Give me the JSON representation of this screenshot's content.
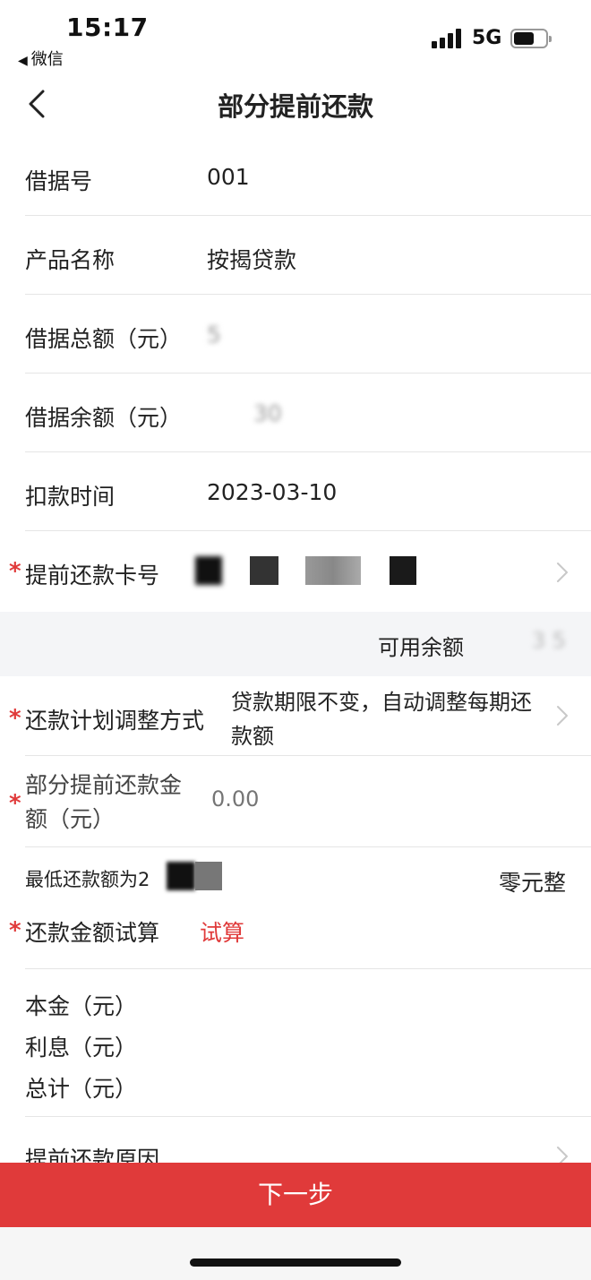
{
  "status_bar": {
    "time": "15:17",
    "back_app": "微信",
    "network": "5G",
    "battery_level": 0.6
  },
  "nav": {
    "title": "部分提前还款"
  },
  "fields": {
    "loan_no_label": "借据号",
    "loan_no_value": "001",
    "product_label": "产品名称",
    "product_value": "按揭贷款",
    "total_label": "借据总额（元）",
    "total_value": "5",
    "balance_label": "借据余额（元）",
    "balance_value": "30",
    "deduct_time_label": "扣款时间",
    "deduct_time_value": "2023-03-10",
    "card_label": "提前还款卡号",
    "available_label": "可用余额",
    "available_value": "3 5",
    "plan_label": "还款计划调整方式",
    "plan_value": "贷款期限不变，自动调整每期还款额",
    "amount_label": "部分提前还款金额（元）",
    "amount_placeholder": "0.00",
    "min_label": "最低还款额为2",
    "min_words": "零元整",
    "trial_label": "还款金额试算",
    "trial_link": "试算",
    "principal_label": "本金（元）",
    "interest_label": "利息（元）",
    "sum_label": "总计（元）",
    "reason_label": "提前还款原因"
  },
  "actions": {
    "next_label": "下一步"
  },
  "colors": {
    "accent": "#e03a3a",
    "band": "#f4f5f7"
  }
}
